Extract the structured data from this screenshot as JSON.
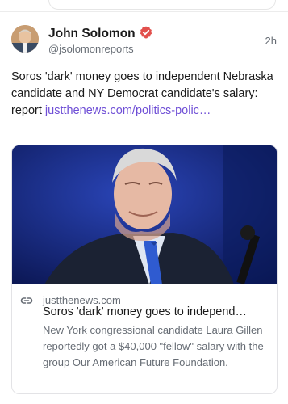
{
  "post": {
    "author_name": "John Solomon",
    "author_handle": "@jsolomonreports",
    "time": "2h",
    "text": "Soros 'dark' money goes to independent Nebraska candidate and NY Democrat candidate's salary: report ",
    "link_text": "justthenews.com/politics-polic…"
  },
  "card": {
    "domain": "justthenews.com",
    "title": "Soros 'dark' money goes to independ…",
    "description": "New York congressional candidate Laura Gillen reportedly got a $40,000 \"fellow\" salary with the group Our American Future Foundation."
  },
  "icons": {
    "verified": "verified-badge-icon",
    "link": "link-icon"
  },
  "colors": {
    "accent": "#6f4fd6",
    "verified_badge": "#e2504c",
    "secondary_text": "#666c74"
  }
}
